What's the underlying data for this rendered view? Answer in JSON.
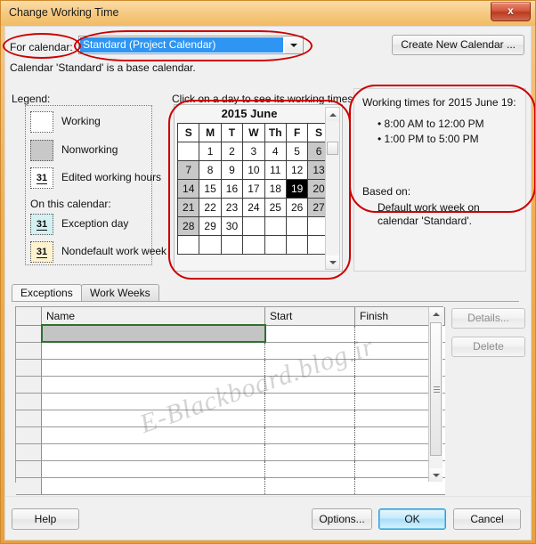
{
  "window": {
    "title": "Change Working Time",
    "close_icon": "close-icon",
    "close_label": "x"
  },
  "calendar_selector": {
    "label": "For calendar:",
    "selected_value": "Standard (Project Calendar)",
    "dropdown_icon": "chevron-down-icon",
    "create_button": "Create New Calendar ...",
    "note": "Calendar 'Standard' is a base calendar."
  },
  "legend": {
    "title": "Legend:",
    "on_this_calendar": "On this calendar:",
    "items": [
      {
        "label": "Working",
        "glyph": "",
        "swatch": "sw-working"
      },
      {
        "label": "Nonworking",
        "glyph": "",
        "swatch": "sw-nonworking"
      },
      {
        "label": "Edited working hours",
        "glyph": "31",
        "swatch": "sw-edited"
      },
      {
        "label": "Exception day",
        "glyph": "31",
        "swatch": "sw-exception"
      },
      {
        "label": "Nondefault work week",
        "glyph": "31",
        "swatch": "sw-nondefault"
      }
    ]
  },
  "calendar": {
    "hint": "Click on a day to see its working times:",
    "month_title": "2015 June",
    "weekday_headers": [
      "S",
      "M",
      "T",
      "W",
      "Th",
      "F",
      "S"
    ],
    "weeks": [
      [
        {
          "d": "",
          "t": "empty"
        },
        {
          "d": "1",
          "t": "work"
        },
        {
          "d": "2",
          "t": "work"
        },
        {
          "d": "3",
          "t": "work"
        },
        {
          "d": "4",
          "t": "work"
        },
        {
          "d": "5",
          "t": "work"
        },
        {
          "d": "6",
          "t": "nonworking"
        }
      ],
      [
        {
          "d": "7",
          "t": "nonworking"
        },
        {
          "d": "8",
          "t": "work"
        },
        {
          "d": "9",
          "t": "work"
        },
        {
          "d": "10",
          "t": "work"
        },
        {
          "d": "11",
          "t": "work"
        },
        {
          "d": "12",
          "t": "work"
        },
        {
          "d": "13",
          "t": "nonworking"
        }
      ],
      [
        {
          "d": "14",
          "t": "nonworking"
        },
        {
          "d": "15",
          "t": "work"
        },
        {
          "d": "16",
          "t": "work"
        },
        {
          "d": "17",
          "t": "work"
        },
        {
          "d": "18",
          "t": "work"
        },
        {
          "d": "19",
          "t": "selected"
        },
        {
          "d": "20",
          "t": "nonworking"
        }
      ],
      [
        {
          "d": "21",
          "t": "nonworking"
        },
        {
          "d": "22",
          "t": "work"
        },
        {
          "d": "23",
          "t": "work"
        },
        {
          "d": "24",
          "t": "work"
        },
        {
          "d": "25",
          "t": "work"
        },
        {
          "d": "26",
          "t": "work"
        },
        {
          "d": "27",
          "t": "nonworking"
        }
      ],
      [
        {
          "d": "28",
          "t": "nonworking"
        },
        {
          "d": "29",
          "t": "work"
        },
        {
          "d": "30",
          "t": "work"
        },
        {
          "d": "",
          "t": "empty"
        },
        {
          "d": "",
          "t": "empty"
        },
        {
          "d": "",
          "t": "empty"
        },
        {
          "d": "",
          "t": "empty"
        }
      ],
      [
        {
          "d": "",
          "t": "empty"
        },
        {
          "d": "",
          "t": "empty"
        },
        {
          "d": "",
          "t": "empty"
        },
        {
          "d": "",
          "t": "empty"
        },
        {
          "d": "",
          "t": "empty"
        },
        {
          "d": "",
          "t": "empty"
        },
        {
          "d": "",
          "t": "empty"
        }
      ]
    ],
    "scroll_up_icon": "triangle-up-icon",
    "scroll_down_icon": "triangle-down-icon"
  },
  "working_times": {
    "title": "Working times for 2015 June 19:",
    "bullets": [
      "• 8:00 AM to 12:00 PM",
      "• 1:00 PM to 5:00 PM"
    ],
    "based_on_label": "Based on:",
    "based_on_detail": "Default work week on calendar 'Standard'."
  },
  "tabs": [
    {
      "label": "Exceptions",
      "active": true
    },
    {
      "label": "Work Weeks",
      "active": false
    }
  ],
  "exceptions_table": {
    "columns": [
      "",
      "Name",
      "Start",
      "Finish"
    ],
    "rows": [
      {
        "selected": true,
        "name": "",
        "start": "",
        "finish": ""
      },
      {
        "selected": false,
        "name": "",
        "start": "",
        "finish": ""
      },
      {
        "selected": false,
        "name": "",
        "start": "",
        "finish": ""
      },
      {
        "selected": false,
        "name": "",
        "start": "",
        "finish": ""
      },
      {
        "selected": false,
        "name": "",
        "start": "",
        "finish": ""
      },
      {
        "selected": false,
        "name": "",
        "start": "",
        "finish": ""
      },
      {
        "selected": false,
        "name": "",
        "start": "",
        "finish": ""
      },
      {
        "selected": false,
        "name": "",
        "start": "",
        "finish": ""
      },
      {
        "selected": false,
        "name": "",
        "start": "",
        "finish": ""
      },
      {
        "selected": false,
        "name": "",
        "start": "",
        "finish": ""
      }
    ],
    "scroll_up_icon": "triangle-up-icon",
    "scroll_down_icon": "triangle-down-icon"
  },
  "side_buttons": {
    "details": "Details...",
    "delete": "Delete"
  },
  "footer_buttons": {
    "help": "Help",
    "options": "Options...",
    "ok": "OK",
    "cancel": "Cancel"
  },
  "watermark": "E-Blackboard.blog.ir",
  "colors": {
    "window_frame": "#e8a13d",
    "titlebar": "#f5c87f",
    "annotation_red": "#cc0000",
    "selection_blue": "#2e95f2",
    "selected_day": "#000000",
    "nonworking_gray": "#c8c8c8",
    "exception_cyan": "#d4f0f0",
    "nondefault_cream": "#fdf3cf",
    "row_select_green": "#2e7031",
    "ok_button_blue": "#a9dff8"
  }
}
